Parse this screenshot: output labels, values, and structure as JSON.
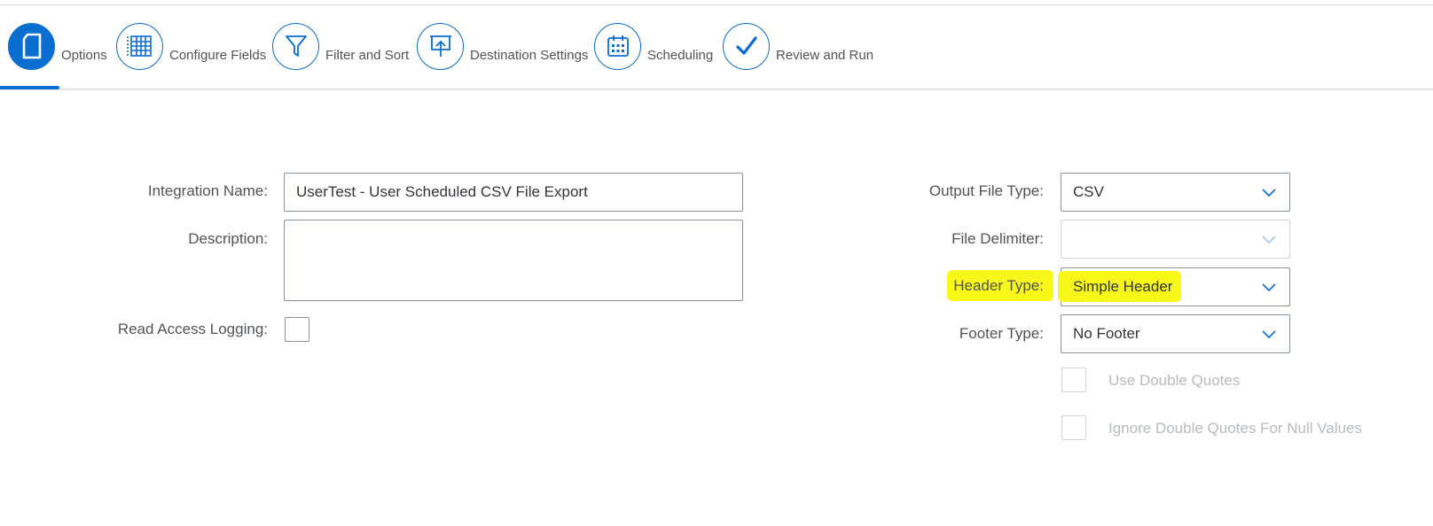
{
  "wizard": {
    "steps": [
      {
        "label": "Options",
        "icon": "document-icon",
        "active": true
      },
      {
        "label": "Configure Fields",
        "icon": "grid-icon",
        "active": false
      },
      {
        "label": "Filter and Sort",
        "icon": "filter-icon",
        "active": false
      },
      {
        "label": "Destination Settings",
        "icon": "upload-board-icon",
        "active": false
      },
      {
        "label": "Scheduling",
        "icon": "calendar-icon",
        "active": false
      },
      {
        "label": "Review and Run",
        "icon": "checkmark-icon",
        "active": false
      }
    ]
  },
  "form": {
    "integration_name": {
      "label": "Integration Name:",
      "value": "UserTest - User Scheduled CSV File Export"
    },
    "description": {
      "label": "Description:",
      "value": ""
    },
    "read_access_logging": {
      "label": "Read Access Logging:",
      "checked": false
    },
    "output_file_type": {
      "label": "Output File Type:",
      "value": "CSV"
    },
    "file_delimiter": {
      "label": "File Delimiter:",
      "value": "",
      "disabled": true
    },
    "header_type": {
      "label": "Header Type:",
      "value": "Simple Header",
      "highlighted": true
    },
    "footer_type": {
      "label": "Footer Type:",
      "value": "No Footer"
    },
    "use_double_quotes": {
      "label": "Use Double Quotes",
      "checked": false,
      "disabled": true
    },
    "ignore_double_quotes_null": {
      "label": "Ignore Double Quotes For Null Values",
      "checked": false,
      "disabled": true
    }
  },
  "colors": {
    "accent": "#0a6ed1",
    "highlight": "#f7f71a",
    "disabled_text": "#b7bbbe"
  }
}
